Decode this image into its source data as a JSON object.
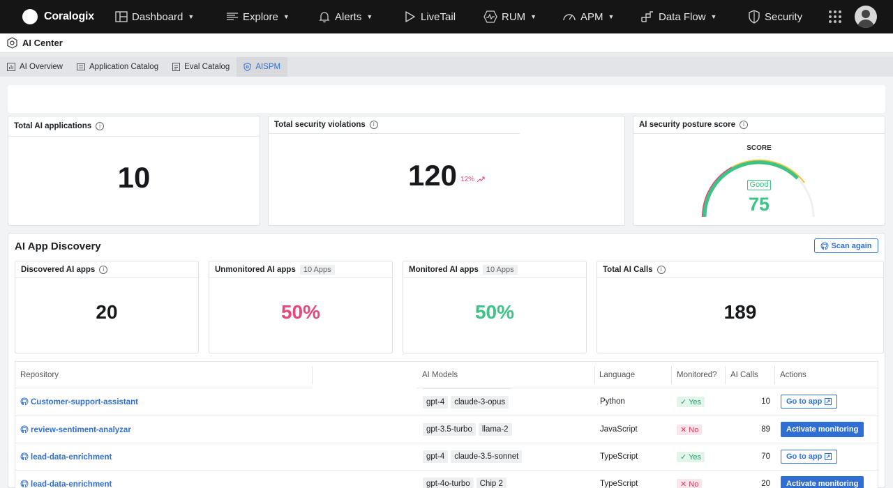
{
  "brand": {
    "name": "Coralogix"
  },
  "nav": [
    {
      "label": "Dashboard",
      "icon": "dashboard-icon",
      "caret": true
    },
    {
      "label": "Explore",
      "icon": "explore-icon",
      "caret": true
    },
    {
      "label": "Alerts",
      "icon": "bell-icon",
      "caret": true
    },
    {
      "label": "LiveTail",
      "icon": "play-icon",
      "caret": false
    },
    {
      "label": "RUM",
      "icon": "rum-icon",
      "caret": true
    },
    {
      "label": "APM",
      "icon": "gauge-icon",
      "caret": true
    },
    {
      "label": "Data Flow",
      "icon": "dataflow-icon",
      "caret": true
    },
    {
      "label": "Security",
      "icon": "shield-icon",
      "caret": false
    }
  ],
  "subheader": {
    "title": "AI Center"
  },
  "tabs": [
    {
      "label": "AI Overview"
    },
    {
      "label": "Application Catalog"
    },
    {
      "label": "Eval Catalog"
    },
    {
      "label": "AISPM"
    }
  ],
  "summary": {
    "total_apps": {
      "title": "Total AI applications",
      "value": "10"
    },
    "violations": {
      "title": "Total security violations",
      "value": "120",
      "trend": "12%"
    },
    "posture": {
      "title": "AI security posture score",
      "score_label": "SCORE",
      "badge": "Good",
      "value": "75",
      "score": 75,
      "max": 100
    }
  },
  "discovery": {
    "title": "AI App Discovery",
    "scan_label": "Scan again",
    "cards": {
      "discovered": {
        "title": "Discovered AI apps",
        "value": "20"
      },
      "unmonitored": {
        "title": "Unmonitored AI apps",
        "badge": "10 Apps",
        "value": "50%"
      },
      "monitored": {
        "title": "Monitored AI apps",
        "badge": "10 Apps",
        "value": "50%"
      },
      "calls": {
        "title": "Total AI Calls",
        "value": "189"
      }
    }
  },
  "table": {
    "headers": {
      "repository": "Repository",
      "models": "AI Models",
      "language": "Language",
      "monitored": "Monitored?",
      "calls": "AI Calls",
      "actions": "Actions"
    },
    "rows": [
      {
        "repo": "Customer-support-assistant",
        "models": [
          "gpt-4",
          "claude-3-opus"
        ],
        "language": "Python",
        "monitored": "Yes",
        "calls": "10",
        "action": "Go to app"
      },
      {
        "repo": "review-sentiment-analyzar",
        "models": [
          "gpt-3.5-turbo",
          "llama-2"
        ],
        "language": "JavaScript",
        "monitored": "No",
        "calls": "89",
        "action": "Activate monitoring"
      },
      {
        "repo": "lead-data-enrichment",
        "models": [
          "gpt-4",
          "claude-3.5-sonnet"
        ],
        "language": "TypeScript",
        "monitored": "Yes",
        "calls": "70",
        "action": "Go to app"
      },
      {
        "repo": "lead-data-enrichment",
        "models": [
          "gpt-4o-turbo",
          "Chip 2"
        ],
        "language": "TypeScript",
        "monitored": "No",
        "calls": "20",
        "action": "Activate monitoring"
      }
    ]
  },
  "colors": {
    "accent": "#2f6fd4",
    "pink": "#e8477a",
    "green": "#3cc486",
    "yellow": "#f0c23c"
  }
}
